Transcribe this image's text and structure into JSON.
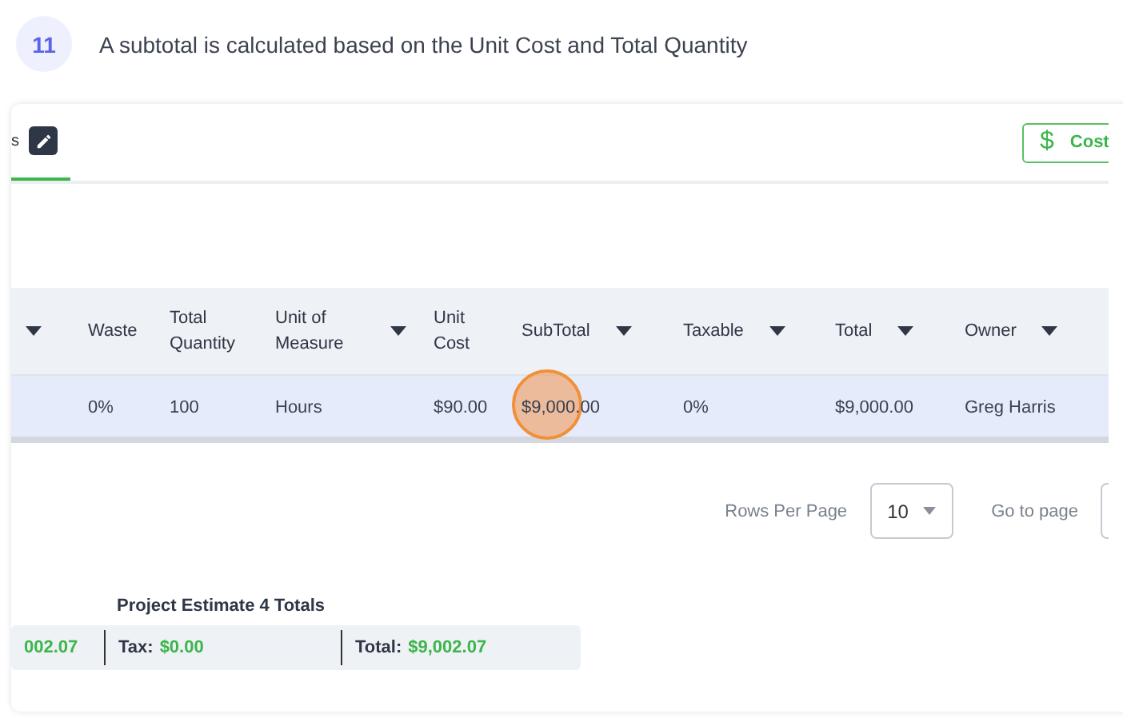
{
  "step": {
    "number": "11",
    "text": "A subtotal is calculated based on the Unit Cost and Total Quantity"
  },
  "tabs": [
    {
      "label": "s",
      "selected": true
    }
  ],
  "cost_button": {
    "icon": "$",
    "label": "Cost"
  },
  "table": {
    "columns": [
      {
        "sortable": true
      },
      {
        "label": "Waste",
        "sortable": false
      },
      {
        "label": "Total Quantity",
        "sortable": false
      },
      {
        "label": "Unit of Measure",
        "sortable": true
      },
      {
        "label": "Unit Cost",
        "sortable": false
      },
      {
        "label": "SubTotal",
        "sortable": true
      },
      {
        "label": "Taxable",
        "sortable": true
      },
      {
        "label": "Total",
        "sortable": true
      },
      {
        "label": "Owner",
        "sortable": true
      }
    ],
    "rows": [
      {
        "selected": true,
        "cells": [
          {
            "text": ""
          },
          {
            "text": "0%",
            "clicked": false
          },
          {
            "text": "100",
            "clicked": false
          },
          {
            "text": "Hours",
            "clicked": false
          },
          {
            "text": "$90.00",
            "clicked": false
          },
          {
            "text": "$9,000.00",
            "clicked": true
          },
          {
            "text": "0%",
            "clicked": false
          },
          {
            "text": "$9,000.00",
            "clicked": false
          },
          {
            "text": "Greg Harris",
            "clicked": false
          }
        ]
      }
    ]
  },
  "pagination": {
    "rows_per_page_label": "Rows Per Page",
    "rows_per_page": "10",
    "go_to_page_label": "Go to page"
  },
  "totals": {
    "title": "Project Estimate 4 Totals",
    "items": [
      {
        "value": "002.07"
      },
      {
        "label": "Tax:",
        "value": "$0.00"
      },
      {
        "label": "Total:",
        "value": "$9,002.07"
      }
    ]
  }
}
